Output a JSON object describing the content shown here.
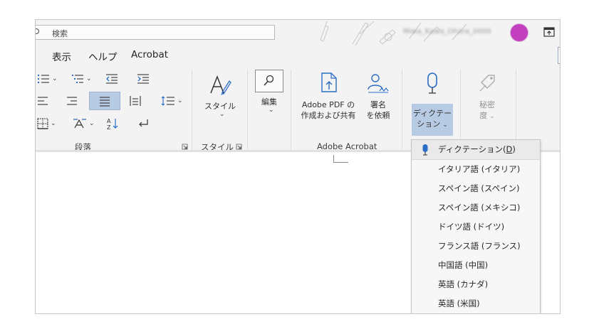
{
  "titlebar": {
    "search_placeholder": "検索",
    "account_text": "Miwa_Kawa_Ohara_0000",
    "avatar_color": "#c23fbd"
  },
  "menubar": {
    "items": [
      "表示",
      "ヘルプ",
      "Acrobat"
    ]
  },
  "ribbon": {
    "paragraph_group_label": "段落",
    "style": {
      "button_label": "スタイル",
      "group_label": "スタイル"
    },
    "edit": {
      "button_label": "編集"
    },
    "acrobat": {
      "create_share_label_line1": "Adobe PDF の",
      "create_share_label_line2": "作成および共有",
      "sign_label_line1": "署名",
      "sign_label_line2": "を依頼",
      "group_label": "Adobe Acrobat"
    },
    "dictate": {
      "label_line1": "ディクテー",
      "label_line2": "ション"
    },
    "sensitivity": {
      "label_line1": "秘密",
      "label_line2": "度"
    }
  },
  "dictate_menu": {
    "first_item": "ディクテーション(",
    "first_item_key": "D",
    "first_item_end": ")",
    "languages": [
      "イタリア語 (イタリア)",
      "スペイン語 (スペイン)",
      "スペイン語 (メキシコ)",
      "ドイツ語 (ドイツ)",
      "フランス語 (フランス)",
      "中国語 (中国)",
      "英語 (カナダ)",
      "英語 (米国)"
    ]
  },
  "colors": {
    "accent_blue": "#2b6cc4",
    "selected_fill": "#b8cbe4"
  }
}
